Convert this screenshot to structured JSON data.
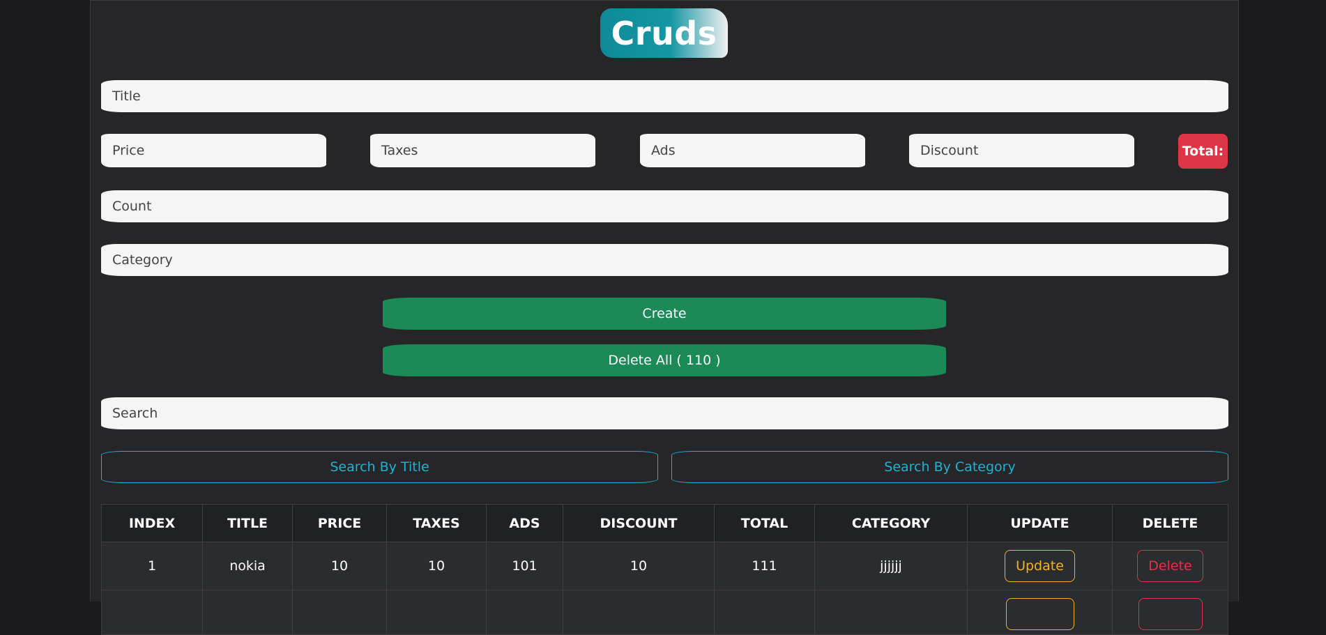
{
  "app": {
    "title": "Cruds"
  },
  "form": {
    "title_placeholder": "Title",
    "price_placeholder": "Price",
    "taxes_placeholder": "Taxes",
    "ads_placeholder": "Ads",
    "discount_placeholder": "Discount",
    "total_label": "Total:",
    "count_placeholder": "Count",
    "category_placeholder": "Category",
    "create_label": "Create",
    "delete_all_label": "Delete All ( 110 )"
  },
  "search": {
    "placeholder": "Search",
    "by_title_label": "Search By Title",
    "by_category_label": "Search By Category"
  },
  "table": {
    "headers": [
      "INDEX",
      "TITLE",
      "PRICE",
      "TAXES",
      "ADS",
      "DISCOUNT",
      "TOTAL",
      "CATEGORY",
      "UPDATE",
      "DELETE"
    ],
    "rows": [
      {
        "index": "1",
        "title": "nokia",
        "price": "10",
        "taxes": "10",
        "ads": "101",
        "discount": "10",
        "total": "111",
        "category": "jjjjjj",
        "update": "Update",
        "delete": "Delete"
      }
    ],
    "partial_row": {
      "update": "",
      "delete": ""
    }
  },
  "colors": {
    "background": "#1b1b1d",
    "panel": "#262628",
    "green": "#1b8a57",
    "red": "#dc3545",
    "cyan": "#1ab3d6",
    "yellow": "#f0b41b",
    "teal": "#0e8a97"
  }
}
